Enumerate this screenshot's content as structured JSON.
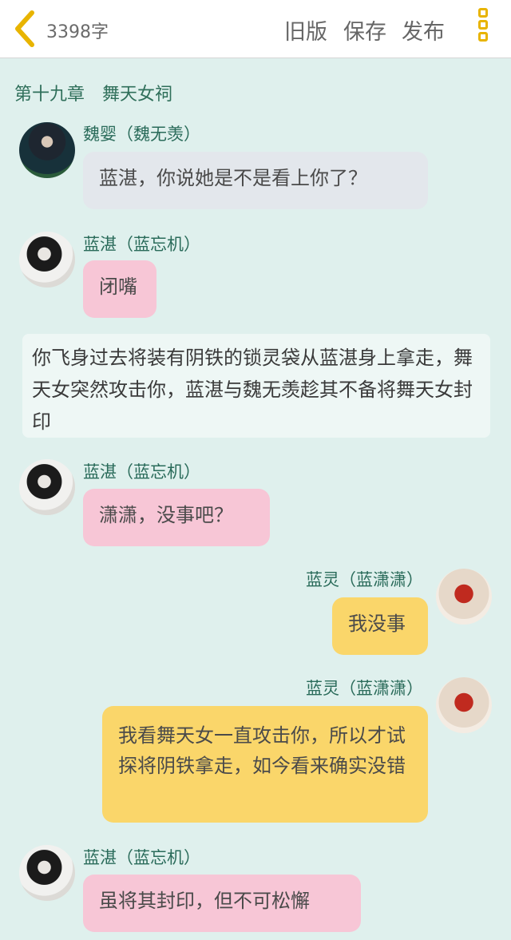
{
  "topbar": {
    "word_count": "3398字",
    "old_version": "旧版",
    "save": "保存",
    "publish": "发布",
    "accent_color": "#e8b400"
  },
  "chapter_title": "第十九章　舞天女祠",
  "messages": [
    {
      "name": "魏婴（魏无羡）",
      "text": "蓝湛，你说她是不是看上你了？"
    },
    {
      "name": "蓝湛（蓝忘机）",
      "text": "闭嘴"
    },
    {
      "narration": "你飞身过去将装有阴铁的锁灵袋从蓝湛身上拿走，舞天女突然攻击你，蓝湛与魏无羡趁其不备将舞天女封印"
    },
    {
      "name": "蓝湛（蓝忘机）",
      "text": "潇潇，没事吧？"
    },
    {
      "name": "蓝灵（蓝潇潇）",
      "text": "我没事"
    },
    {
      "name": "蓝灵（蓝潇潇）",
      "text": "我看舞天女一直攻击你，所以才试探将阴铁拿走，如今看来确实没错"
    },
    {
      "name": "蓝湛（蓝忘机）",
      "text": "虽将其封印，但不可松懈"
    }
  ]
}
